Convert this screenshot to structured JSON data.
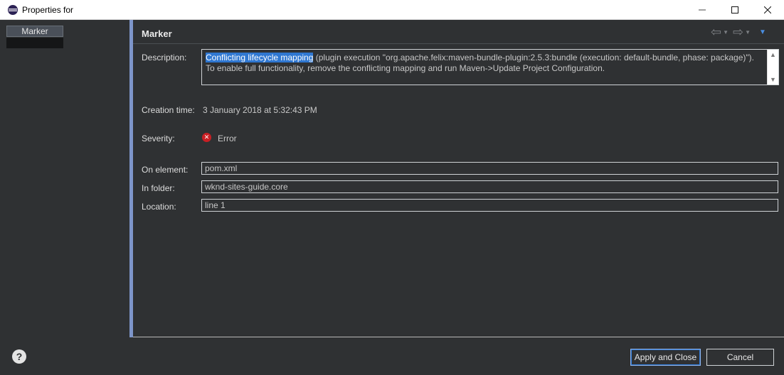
{
  "window": {
    "title": "Properties for",
    "icon": "eclipse-icon",
    "minimize_icon": "minimize-icon",
    "maximize_icon": "maximize-icon",
    "close_icon": "close-icon"
  },
  "tree": {
    "items": [
      {
        "label": "Marker",
        "selected": true
      }
    ]
  },
  "page": {
    "title": "Marker",
    "nav": {
      "back_icon": "back-arrow-icon",
      "forward_icon": "forward-arrow-icon",
      "menu_icon": "view-menu-icon"
    },
    "description": {
      "label": "Description:",
      "highlighted": "Conflicting lifecycle mapping",
      "line1_rest": " (plugin execution \"org.apache.felix:maven-bundle-plugin:2.5.3:bundle (execution: default-bundle, phase: package)\").",
      "line2": "To enable full functionality, remove the conflicting mapping and run Maven->Update Project Configuration."
    },
    "creation_time": {
      "label": "Creation time:",
      "value": "3 January 2018 at 5:32:43 PM"
    },
    "severity": {
      "label": "Severity:",
      "value": "Error",
      "icon": "error-icon",
      "color": "#c91f24"
    },
    "on_element": {
      "label": "On element:",
      "value": "pom.xml"
    },
    "in_folder": {
      "label": "In folder:",
      "value": "wknd-sites-guide.core"
    },
    "location": {
      "label": "Location:",
      "value": "line 1"
    }
  },
  "footer": {
    "help_icon": "help-icon",
    "apply_label": "Apply and Close",
    "cancel_label": "Cancel"
  },
  "colors": {
    "accent": "#2f77d1",
    "splitter": "#7d95c9",
    "background": "#2f3133"
  }
}
